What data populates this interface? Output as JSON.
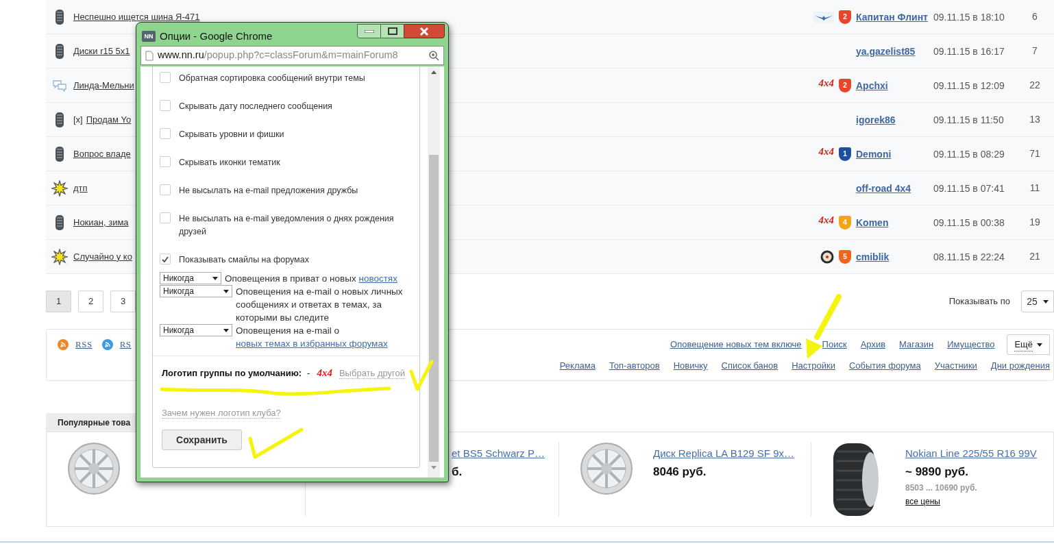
{
  "forum_rows": [
    {
      "kind": "tire",
      "title": "Неспешно ищется шина Я-471",
      "logo": {
        "kind": "wings"
      },
      "badge": {
        "number": "2",
        "color": "#e8452c"
      },
      "user": "Капитан Флинт",
      "date": "09.11.15 в 18:10",
      "replies": "6"
    },
    {
      "kind": "tire",
      "title": "Диски r15 5х1",
      "user": "ya.gazelist85",
      "date": "09.11.15 в 16:17",
      "replies": "7"
    },
    {
      "kind": "chat",
      "title": "Линда-Мельни",
      "logo": {
        "kind": "text",
        "text": "4x4"
      },
      "badge": {
        "number": "2",
        "color": "#e8452c"
      },
      "user": "Apchxi",
      "date": "09.11.15 в 12:09",
      "replies": "22"
    },
    {
      "kind": "tire",
      "prefix": "[x]",
      "title": "Продам Yo",
      "user": "igorek86",
      "date": "09.11.15 в 11:50",
      "replies": "13"
    },
    {
      "kind": "tire",
      "title": "Вопрос владе",
      "logo": {
        "kind": "text",
        "text": "4x4"
      },
      "badge": {
        "number": "1",
        "color": "#1d4f9e"
      },
      "user": "Demoni",
      "date": "09.11.15 в 08:29",
      "replies": "71"
    },
    {
      "kind": "star",
      "title": "дтп",
      "user": "off-road 4x4",
      "date": "09.11.15 в 07:41",
      "replies": "11"
    },
    {
      "kind": "tire",
      "title": "Нокиан, зима",
      "logo": {
        "kind": "text",
        "text": "4x4"
      },
      "badge": {
        "number": "4",
        "color": "#f2a516"
      },
      "user": "Komen",
      "date": "09.11.15 в 00:38",
      "replies": "19"
    },
    {
      "kind": "star",
      "title": "Случайно у ко",
      "logo": {
        "kind": "target"
      },
      "badge": {
        "number": "5",
        "color": "#f0641c"
      },
      "user": "cmiblik",
      "date": "08.11.15 в 22:24",
      "replies": "21"
    }
  ],
  "pagination": {
    "pages": [
      {
        "label": "1",
        "selected": true
      },
      {
        "label": "2",
        "selected": false
      },
      {
        "label": "3",
        "selected": false
      }
    ],
    "per_page_label": "Показывать по",
    "per_page": "25"
  },
  "feeds": [
    {
      "label": "RSS",
      "color": "#f0862a"
    },
    {
      "label": "RS",
      "color": "#3a9be0"
    }
  ],
  "nav_links": {
    "row_1": [
      "Оповещение новых тем включе",
      "Поиск",
      "Архив",
      "Магазин",
      "Имущество"
    ],
    "more": "Ещё",
    "row_2": [
      "Реклама",
      "Топ-авторов",
      "Новичку",
      "Список банов",
      "Настройки",
      "События форума",
      "Участники",
      "Дни рождения"
    ]
  },
  "popular": {
    "title": "Популярные това",
    "products": [
      {
        "kind": "wheel"
      },
      {
        "kind": "hidden",
        "name": "et BS5 Schwarz P…",
        "price": "б."
      },
      {
        "kind": "wheel",
        "name": "Диск Replica LA B129 SF 9x…",
        "price": "8046 руб."
      },
      {
        "kind": "tire",
        "name": "Nokian Line 225/55 R16 99V",
        "price": "~ 9890 руб.",
        "range": "8503 ... 10690 руб.",
        "all_prices": "все цены"
      }
    ]
  },
  "popup": {
    "app_icon": "NN",
    "title": "Опции - Google Chrome",
    "url_host": "www.nn.ru",
    "url_path": "/popup.php?c=classForum&m=mainForum8",
    "options": [
      {
        "label": "Обратная сортировка сообщений внутри темы",
        "checked": false
      },
      {
        "label": "Скрывать дату последнего сообщения",
        "checked": false
      },
      {
        "label": "Скрывать уровни и фишки",
        "checked": false
      },
      {
        "label": "Скрывать иконки тематик",
        "checked": false
      },
      {
        "label": "Не высылать на e-mail предложения дружбы",
        "checked": false
      },
      {
        "label": "Не высылать на e-mail уведомления о днях рождения друзей",
        "checked": false
      },
      {
        "label": "Показывать смайлы на форумах",
        "checked": true
      }
    ],
    "notifications": [
      {
        "select": "Никогда",
        "text": "Оповещения в приват о новых",
        "link": "новостях"
      },
      {
        "select": "Никогда",
        "text": "Оповещения на e-mail о новых личных сообщениях и ответах в темах, за которыми вы следите"
      },
      {
        "select": "Никогда",
        "text": "Оповещения на e-mail о",
        "link": "новых темах в избранных форумах"
      }
    ],
    "logo": {
      "label": "Логотип группы по умолчанию:",
      "dash": "-",
      "value": "4x4",
      "change_link": "Выбрать другой"
    },
    "help_link": "Зачем нужен логотип клуба?",
    "save": "Сохранить"
  }
}
